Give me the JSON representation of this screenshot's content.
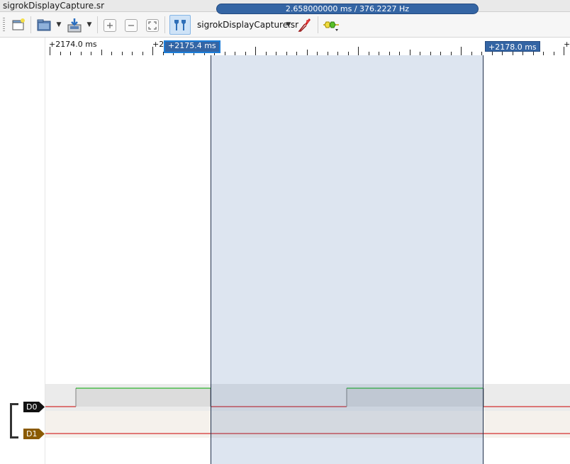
{
  "window": {
    "title": "sigrokDisplayCapture.sr"
  },
  "toolbar": {
    "device_name": "sigrokDisplayCapture.sr",
    "icons": [
      "new-session-icon",
      "open-icon",
      "save-icon",
      "zoom-in-icon",
      "zoom-out-icon",
      "zoom-fit-icon",
      "cursor-icon",
      "device-dropdown-icon",
      "probe-icon",
      "decoder-icon"
    ]
  },
  "ruler": {
    "labels": [
      "+2174.0 ms",
      "+2",
      "+2178.0 ms",
      "+2"
    ],
    "cursor_left": "+2175.4 ms",
    "cursor_right": "+2178.0 ms",
    "measurement": "2.658000000 ms / 376.2227 Hz"
  },
  "channels": [
    {
      "name": "D0",
      "color": "#111111"
    },
    {
      "name": "D1",
      "color": "#8a5a00"
    }
  ],
  "colors": {
    "selection": "#3465a4",
    "high_line": "#00aa00",
    "low_line": "#cc0000"
  }
}
